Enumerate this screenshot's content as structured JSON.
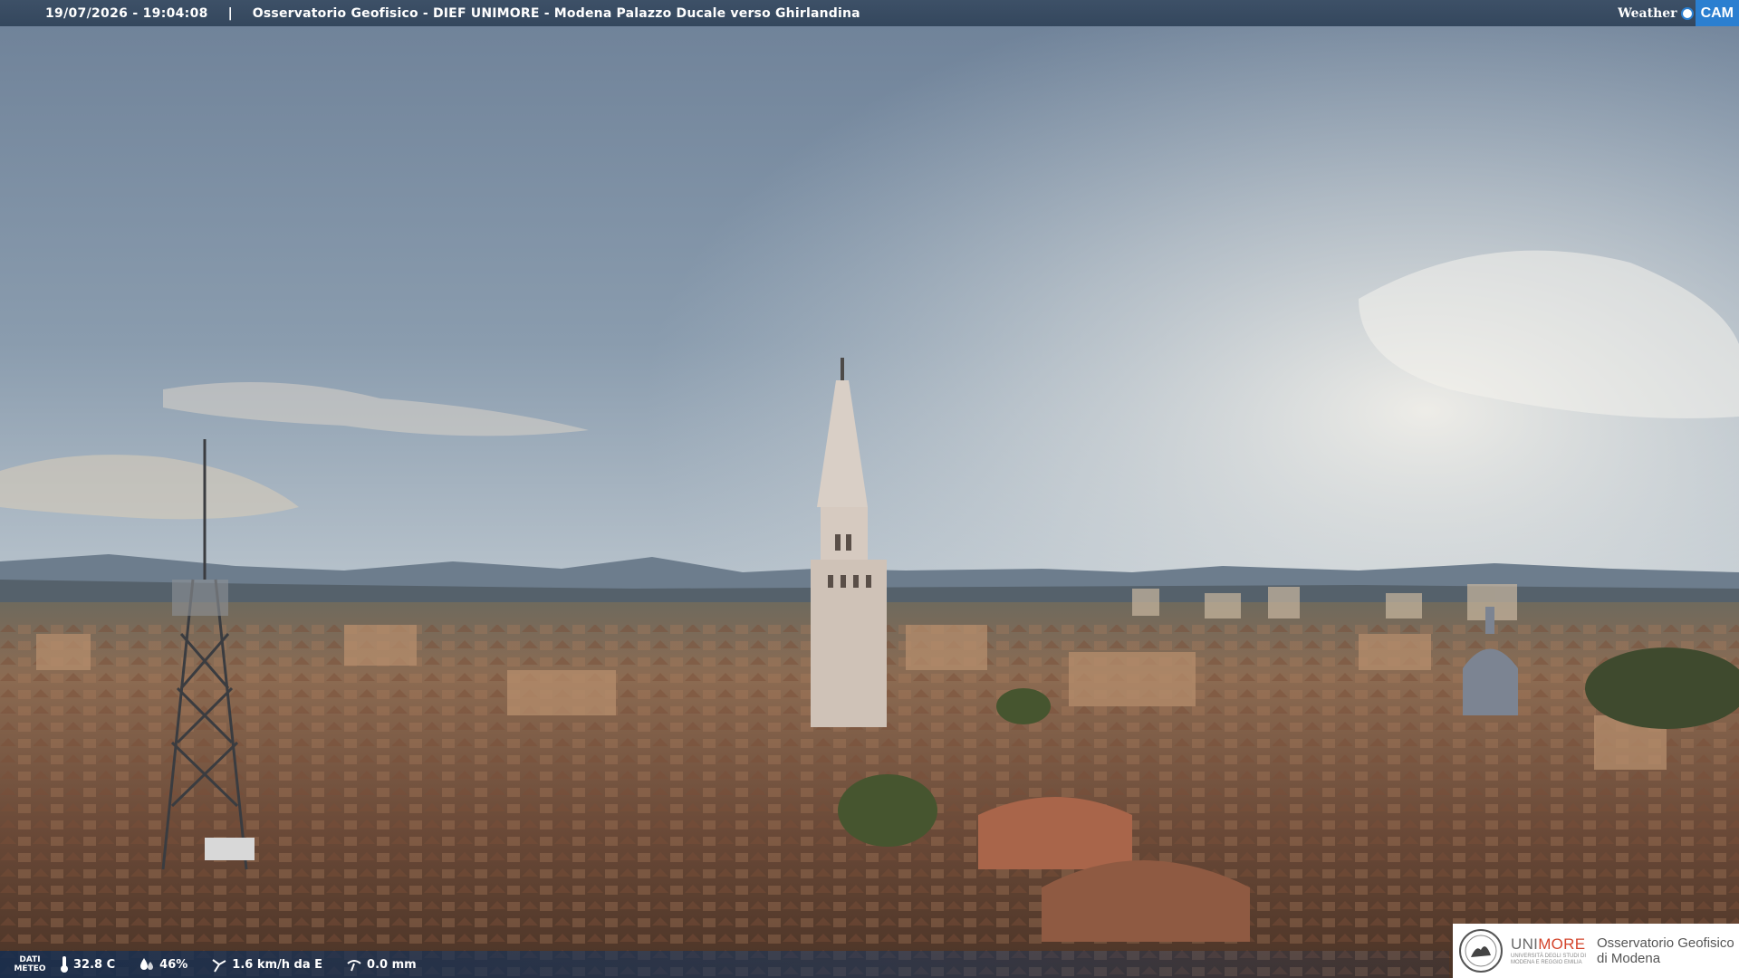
{
  "header": {
    "timestamp": "19/07/2026 - 19:04:08",
    "separator": "|",
    "title": "Osservatorio Geofisico - DIEF UNIMORE - Modena Palazzo Ducale verso Ghirlandina",
    "brand_weather": "Weather",
    "brand_cam": "CAM"
  },
  "meteo": {
    "label_line1": "DATI",
    "label_line2": "METEO",
    "temperature": "32.8 C",
    "humidity": "46%",
    "wind": "1.6 km/h da E",
    "rain": "0.0 mm"
  },
  "logo": {
    "university": "UNI",
    "university_highlight": "MORE",
    "university_sub1": "UNIVERSITÀ DEGLI STUDI DI",
    "university_sub2": "MODENA E REGGIO EMILIA",
    "observatory_line1": "Osservatorio Geofisico",
    "observatory_line2": "di Modena"
  },
  "colors": {
    "header_bg": "#3d5067",
    "brand_blue": "#2b7fd0",
    "unimore_red": "#d4452c"
  },
  "icons": [
    "thermometer-icon",
    "humidity-icon",
    "wind-icon",
    "rain-gauge-icon",
    "university-seal-icon"
  ]
}
